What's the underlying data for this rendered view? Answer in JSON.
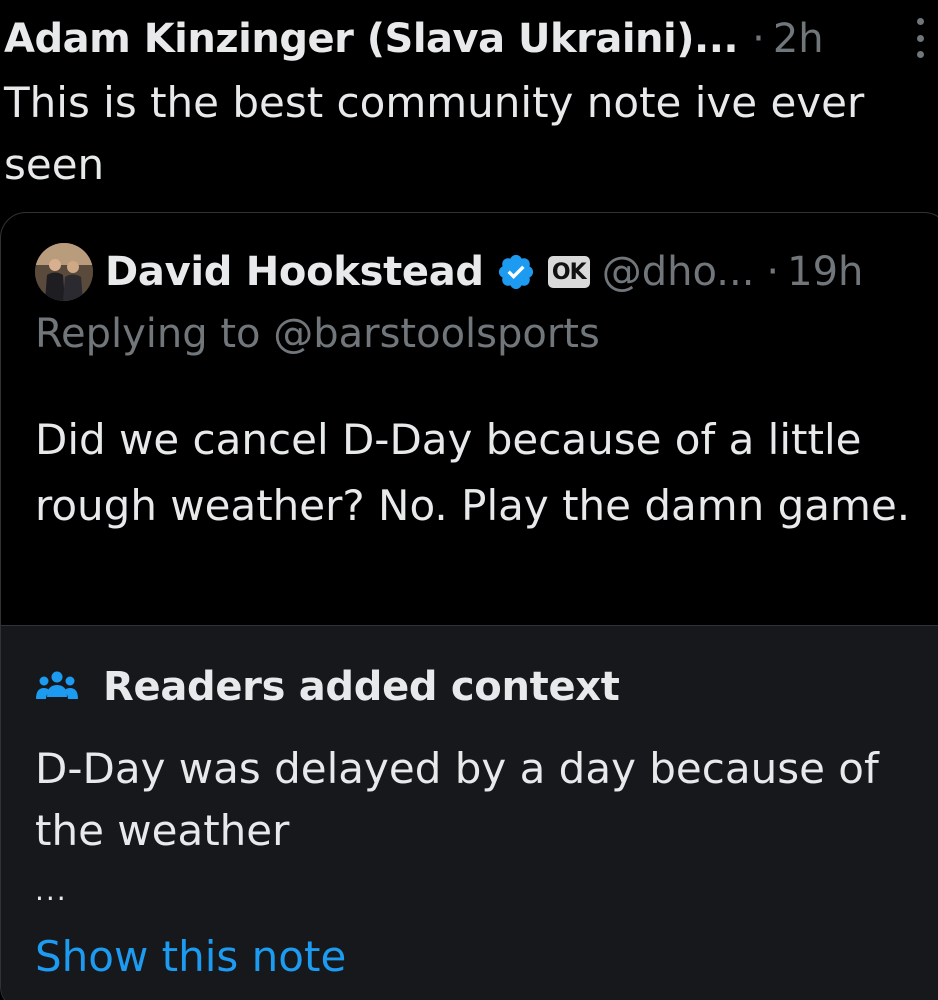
{
  "post": {
    "author_name": "Adam Kinzinger (Slava Ukraini)...",
    "separator": "·",
    "timestamp": "2h",
    "text": "This is the best community note ive ever seen",
    "more_icon": "more-vertical-icon"
  },
  "quoted": {
    "name": "David Hookstead",
    "verified_icon": "verified-badge-icon",
    "affiliate_badge": "OK",
    "handle": "@dho...",
    "separator": "·",
    "timestamp": "19h",
    "replying_to": "Replying to @barstoolsports",
    "text": "Did we cancel D-Day because of a little rough weather? No. Play the damn game."
  },
  "community_note": {
    "icon": "people-icon",
    "title": "Readers added context",
    "text": "D-Day was delayed by a day because of the weather",
    "ellipsis": "...",
    "show_link": "Show this note"
  },
  "colors": {
    "background": "#000000",
    "text_primary": "#e7e9ea",
    "text_secondary": "#71767b",
    "accent_blue": "#1d9bf0",
    "note_background": "#16181c",
    "border": "#2f3336"
  }
}
